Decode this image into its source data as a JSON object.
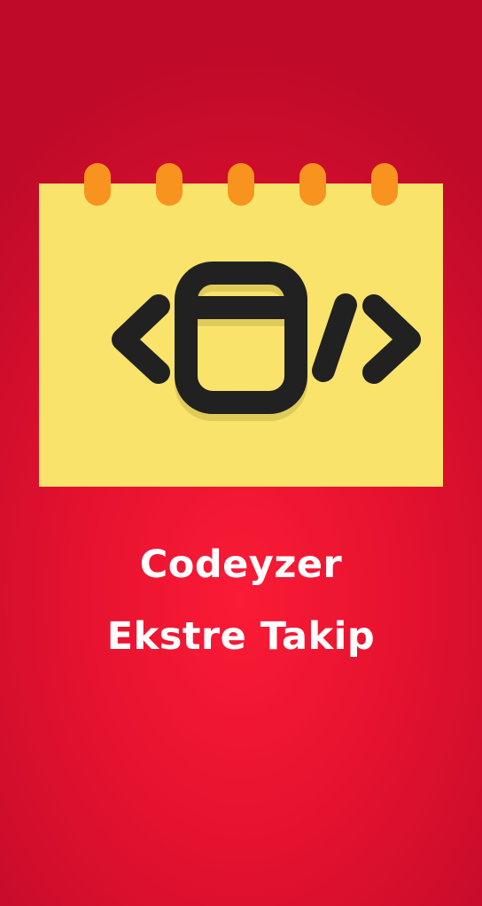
{
  "app": {
    "name_line1": "Codeyzer",
    "name_line2": "Ekstre Takip"
  },
  "logo": {
    "icon": "calendar-code-icon",
    "colors": {
      "paper": "#f9e36b",
      "rings": "#f7931e",
      "glyph": "#212121",
      "shadow": "#dfcb5a"
    }
  },
  "colors": {
    "background_center": "#fb1b36",
    "background_edge": "#c00a2a",
    "text": "#ffffff"
  }
}
